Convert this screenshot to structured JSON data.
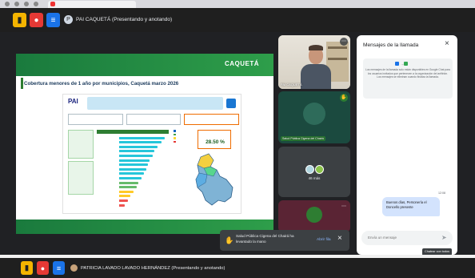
{
  "top_bar": {
    "present_label": "PAI CAQUETÁ (Presentando y anotando)"
  },
  "slide": {
    "logo": "CAQUETÁ",
    "title": "Cobertura menores de 1 año por municipios, Caquetá marzo 2026",
    "paif_logo": "PAI",
    "pct_value": "28.50 %"
  },
  "tiles": {
    "cam_name": "PAI CAQUETÁ",
    "g1_name": "Salud Pública Cigena del Chairá",
    "g2_more": "46 más"
  },
  "toast": {
    "text": "Salud Pública Cigena del Chairá ha levantado la mano",
    "open_label": "Abrir fila"
  },
  "chat": {
    "title": "Mensajes de la llamada",
    "info": "Los mensajes de la llamada solo están disponibles en Google Chat para los usuarios invitados que pertenecen a la organización del anfitrión. Los mensajes se eliminan cuando finaliza la llamada.",
    "time": "12:08",
    "bubble": "Buenos días, Personería el Doncello presente",
    "input_placeholder": "Envía un mensaje",
    "tooltip": "Chatear con todos"
  },
  "bottom": {
    "present_label": "PATRICIA LAVADO LAVADO HERNÁNDEZ (Presentando y anotando)"
  },
  "colors": {
    "meet_bg": "#202124",
    "slide_green": "#2e9e4a",
    "chat_bubble": "#d3e3fd",
    "link_blue": "#8ab4f8"
  }
}
